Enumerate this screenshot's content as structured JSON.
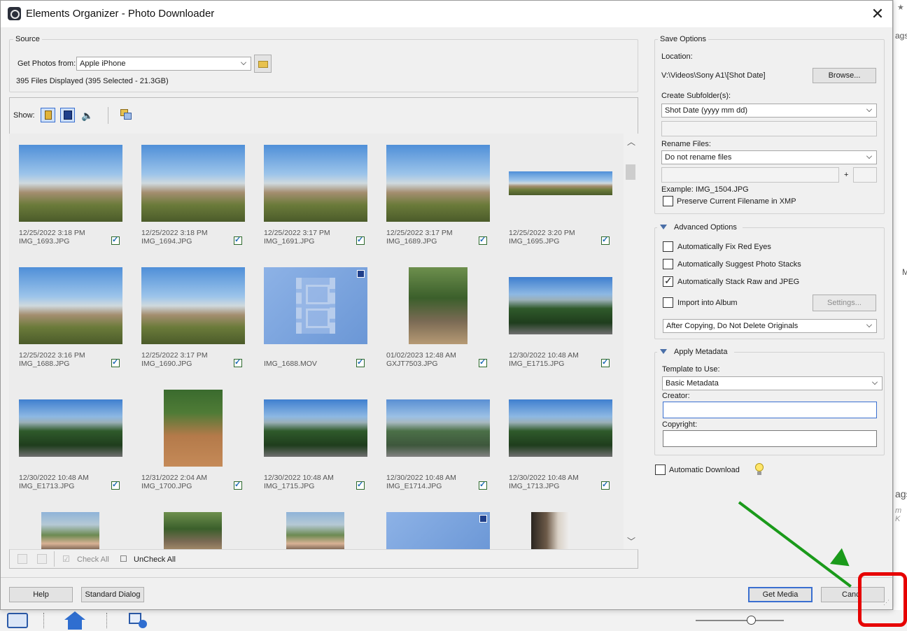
{
  "window": {
    "title": "Elements Organizer - Photo Downloader"
  },
  "source": {
    "group_title": "Source",
    "get_photos_label": "Get Photos from:",
    "device": "Apple iPhone",
    "status": "395 Files Displayed (395 Selected - 21.3GB)"
  },
  "show_bar": {
    "label": "Show:"
  },
  "thumbnails": [
    {
      "date": "12/25/2022 3:18 PM",
      "name": "IMG_1693.JPG"
    },
    {
      "date": "12/25/2022 3:18 PM",
      "name": "IMG_1694.JPG"
    },
    {
      "date": "12/25/2022 3:17 PM",
      "name": "IMG_1691.JPG"
    },
    {
      "date": "12/25/2022 3:17 PM",
      "name": "IMG_1689.JPG"
    },
    {
      "date": "12/25/2022 3:20 PM",
      "name": "IMG_1695.JPG"
    },
    {
      "date": "12/25/2022 3:16 PM",
      "name": "IMG_1688.JPG"
    },
    {
      "date": "12/25/2022 3:17 PM",
      "name": "IMG_1690.JPG"
    },
    {
      "date": "",
      "name": "IMG_1688.MOV"
    },
    {
      "date": "01/02/2023 12:48 AM",
      "name": "GXJT7503.JPG"
    },
    {
      "date": "12/30/2022 10:48 AM",
      "name": "IMG_E1715.JPG"
    },
    {
      "date": "12/30/2022 10:48 AM",
      "name": "IMG_E1713.JPG"
    },
    {
      "date": "12/31/2022 2:04 AM",
      "name": "IMG_1700.JPG"
    },
    {
      "date": "12/30/2022 10:48 AM",
      "name": "IMG_1715.JPG"
    },
    {
      "date": "12/30/2022 10:48 AM",
      "name": "IMG_E1714.JPG"
    },
    {
      "date": "12/30/2022 10:48 AM",
      "name": "IMG_1713.JPG"
    }
  ],
  "bottom_toolbar": {
    "check_all": "Check All",
    "uncheck_all": "UnCheck All"
  },
  "save_options": {
    "group_title": "Save Options",
    "location_label": "Location:",
    "location_value": "V:\\Videos\\Sony A1\\[Shot Date]",
    "browse": "Browse...",
    "subfolder_label": "Create Subfolder(s):",
    "subfolder_value": "Shot Date (yyyy mm dd)",
    "rename_label": "Rename Files:",
    "rename_value": "Do not rename files",
    "plus": "+",
    "example": "Example:  IMG_1504.JPG",
    "preserve": "Preserve Current Filename in XMP"
  },
  "advanced": {
    "group_title": "Advanced Options",
    "red_eye": "Automatically Fix Red Eyes",
    "suggest_stacks": "Automatically Suggest Photo Stacks",
    "stack_raw": "Automatically Stack Raw and JPEG",
    "import_album": "Import into Album",
    "settings": "Settings...",
    "after_copying": "After Copying, Do Not Delete Originals"
  },
  "metadata": {
    "group_title": "Apply Metadata",
    "template_label": "Template to Use:",
    "template_value": "Basic Metadata",
    "creator_label": "Creator:",
    "copyright_label": "Copyright:"
  },
  "auto_download": "Automatic Download",
  "footer": {
    "help": "Help",
    "standard_dialog": "Standard Dialog",
    "get_media": "Get Media",
    "cancel": "Canc"
  },
  "background": {
    "right_text_1": "ags",
    "right_text_2": "ags",
    "right_text_3": "m K",
    "right_text_4": "M"
  },
  "colors": {
    "accent_border": "#3a6fd0",
    "annotation_arrow": "#1a9a1a",
    "annotation_box": "#e60000"
  }
}
